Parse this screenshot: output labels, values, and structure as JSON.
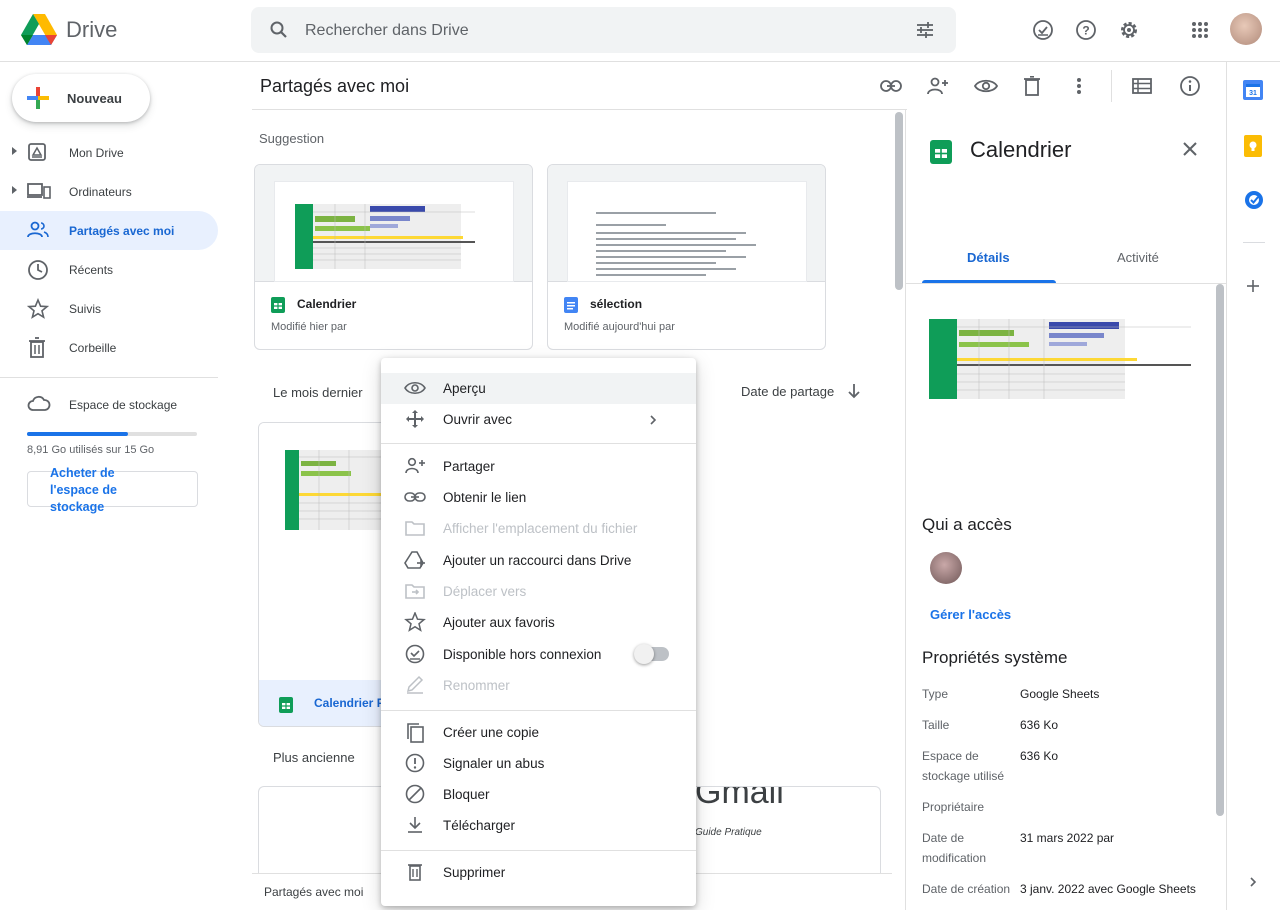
{
  "app": {
    "name": "Drive"
  },
  "search": {
    "placeholder": "Rechercher dans Drive"
  },
  "header": {
    "icons": [
      "offline-ready-icon",
      "help-icon",
      "settings-icon",
      "apps-icon"
    ]
  },
  "sidebar": {
    "new_label": "Nouveau",
    "items": [
      {
        "label": "Mon Drive",
        "icon": "my-drive-icon"
      },
      {
        "label": "Ordinateurs",
        "icon": "computers-icon"
      },
      {
        "label": "Partagés avec moi",
        "icon": "shared-icon",
        "active": true
      },
      {
        "label": "Récents",
        "icon": "clock-icon"
      },
      {
        "label": "Suivis",
        "icon": "star-icon"
      },
      {
        "label": "Corbeille",
        "icon": "trash-icon"
      }
    ],
    "storage": {
      "label": "Espace de stockage",
      "used_text": "8,91 Go utilisés sur 15 Go",
      "used_fraction": 0.594,
      "buy_label": "Acheter de l'espace de stockage"
    }
  },
  "main": {
    "title": "Partagés avec moi",
    "suggestion_heading": "Suggestion",
    "suggestions": [
      {
        "name": "Calendrier",
        "meta": "Modifié hier par",
        "type": "sheets"
      },
      {
        "name": "sélection",
        "meta": "Modifié aujourd'hui par",
        "type": "docs"
      }
    ],
    "section_last_month": "Le mois dernier",
    "sort_label": "Date de partage",
    "selected_file": "Calendrier F",
    "section_older": "Plus ancienne",
    "older_doc_title": "Gmail",
    "older_doc_subtitle": "Guide Pratique",
    "breadcrumb": "Partagés avec moi"
  },
  "context_menu": {
    "items": [
      {
        "label": "Aperçu",
        "icon": "eye-icon"
      },
      {
        "label": "Ouvrir avec",
        "icon": "move-arrows-icon"
      },
      {
        "label": "Partager",
        "icon": "add-person-icon"
      },
      {
        "label": "Obtenir le lien",
        "icon": "link-icon"
      },
      {
        "label": "Afficher l'emplacement du fichier",
        "icon": "folder-icon"
      },
      {
        "label": "Ajouter un raccourci dans Drive",
        "icon": "drive-shortcut-icon"
      },
      {
        "label": "Déplacer vers",
        "icon": "move-to-folder-icon"
      },
      {
        "label": "Ajouter aux favoris",
        "icon": "star-icon"
      },
      {
        "label": "Disponible hors connexion",
        "icon": "offline-icon"
      },
      {
        "label": "Renommer",
        "icon": "pencil-icon"
      },
      {
        "label": "Créer une copie",
        "icon": "copy-icon"
      },
      {
        "label": "Signaler un abus",
        "icon": "report-icon"
      },
      {
        "label": "Bloquer",
        "icon": "block-icon"
      },
      {
        "label": "Télécharger",
        "icon": "download-icon"
      },
      {
        "label": "Supprimer",
        "icon": "trash-icon"
      }
    ]
  },
  "details": {
    "title": "Calendrier",
    "tabs": [
      "Détails",
      "Activité"
    ],
    "access_heading": "Qui a accès",
    "manage_access": "Gérer l'accès",
    "props_heading": "Propriétés système",
    "props": [
      {
        "key": "Type",
        "value": "Google Sheets"
      },
      {
        "key": "Taille",
        "value": "636 Ko"
      },
      {
        "key": "Espace de stockage utilisé",
        "value": "636 Ko"
      },
      {
        "key": "Propriétaire",
        "value": ""
      },
      {
        "key": "Date de modification",
        "value": "31 mars 2022 par"
      },
      {
        "key": "Date de création",
        "value": "3 janv. 2022 avec Google Sheets"
      }
    ]
  },
  "colors": {
    "accent": "#1a73e8",
    "active_bg": "#e8f0fe",
    "sheets_green": "#0f9d58",
    "docs_blue": "#4285f4"
  }
}
